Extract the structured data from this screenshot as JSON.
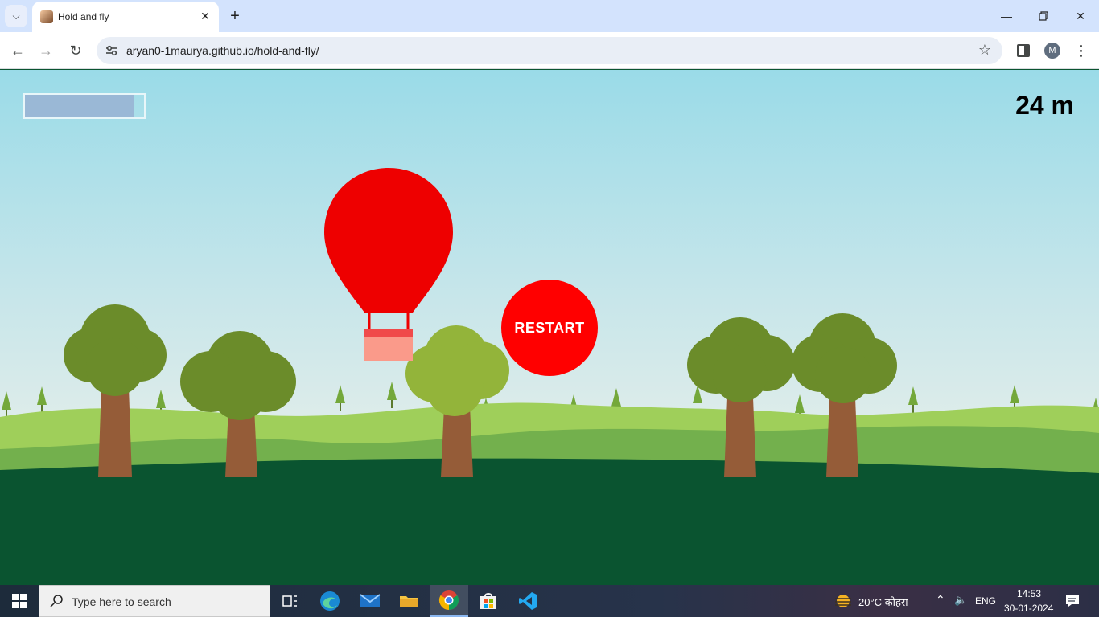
{
  "browser": {
    "tab_title": "Hold and fly",
    "url": "aryan0-1maurya.github.io/hold-and-fly/",
    "profile_initial": "M",
    "icons": [
      "tab-search-icon",
      "close-icon",
      "plus-icon",
      "minimize-icon",
      "restore-icon",
      "close-window-icon",
      "back-icon",
      "forward-icon",
      "reload-icon",
      "site-settings-icon",
      "star-icon",
      "side-panel-icon",
      "kebab-menu-icon"
    ]
  },
  "game": {
    "distance": "24 m",
    "restart_label": "RESTART",
    "fuel_level": 0.92,
    "colors": {
      "balloon": "#ee0000",
      "basket_top": "#f04a4a",
      "basket": "#fa9a8a",
      "restart": "#ff0000",
      "ground": "#0a5430",
      "hill_front": "#73b04d",
      "hill_back": "#9fcf5a",
      "tree_foliage": "#6b8c2a",
      "tree_foliage_light": "#93b43a",
      "tree_trunk": "#955c38"
    }
  },
  "taskbar": {
    "search_placeholder": "Type here to search",
    "weather": "20°C  कोहरा",
    "language": "ENG",
    "time": "14:53",
    "date": "30-01-2024",
    "apps": [
      "task-view-icon",
      "edge-icon",
      "mail-icon",
      "file-explorer-icon",
      "chrome-icon",
      "store-icon",
      "vscode-icon"
    ]
  }
}
